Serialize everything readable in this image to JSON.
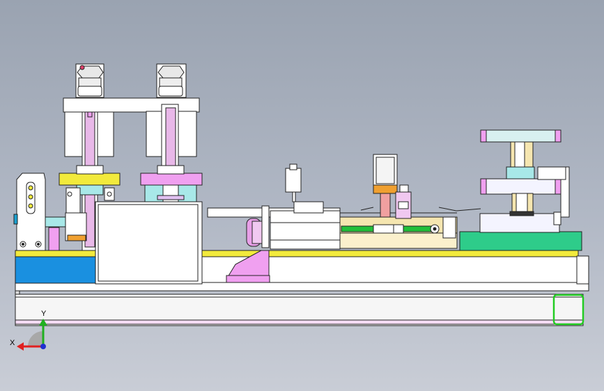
{
  "viewport": {
    "background_top": "#9aa3b1",
    "background_bottom": "#c9cdd6",
    "model_view": "front"
  },
  "triad": {
    "x_label": "X",
    "y_label": "Y",
    "x_color": "#e02020",
    "y_color": "#20b020",
    "z_color": "#2030d0"
  },
  "part_colors": {
    "frame": "#ffffff",
    "plate_yellow": "#f2ea3c",
    "block_blue": "#1a90e0",
    "guide_pink": "#f0a0f0",
    "clamp_cyan": "#a8e8e8",
    "base_green": "#2ecc8a",
    "rail_green": "#22c03a",
    "nut_orange": "#f0a030",
    "slide_beige": "#f5e6b0",
    "selected_outline": "#22cc22"
  }
}
